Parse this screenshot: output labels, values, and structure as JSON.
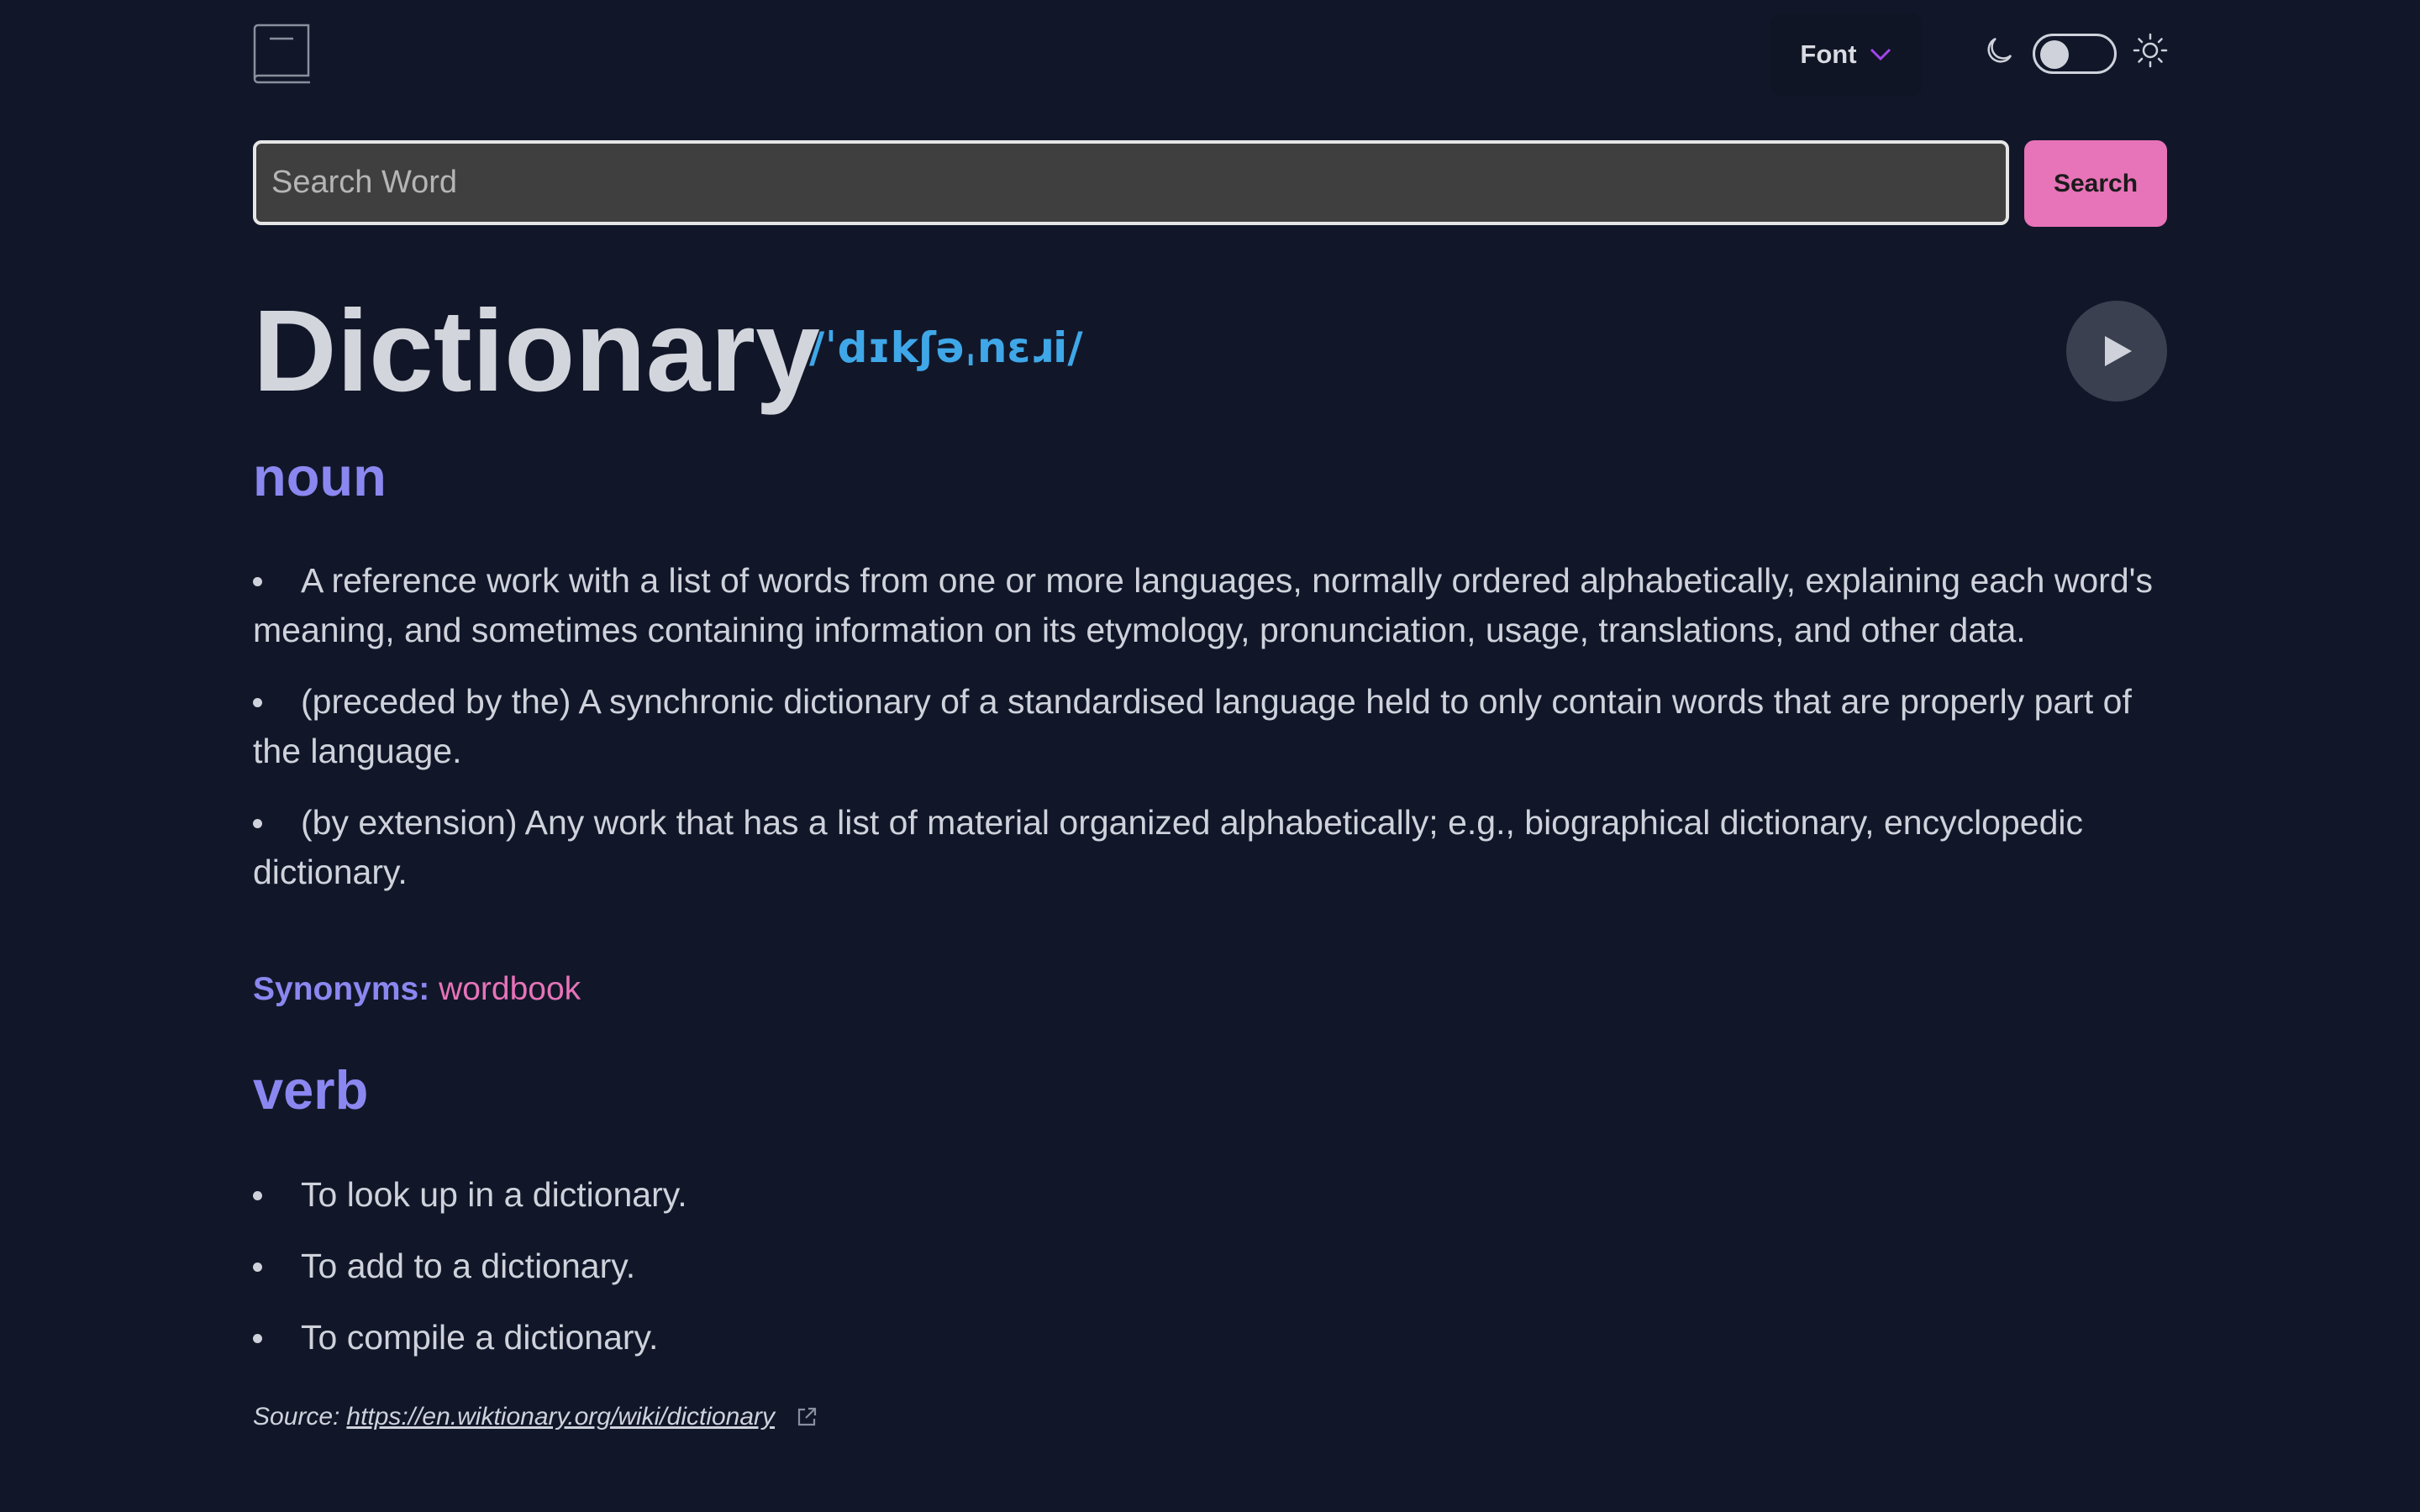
{
  "header": {
    "logo_icon": "book-icon",
    "font_label": "Font",
    "font_chevron_icon": "chevron-down-icon",
    "theme": {
      "moon_icon": "moon-icon",
      "sun_icon": "sun-icon",
      "mode": "dark"
    }
  },
  "search": {
    "placeholder": "Search Word",
    "value": "",
    "button_label": "Search"
  },
  "entry": {
    "word": "Dictionary",
    "phonetic": "/ˈdɪkʃəˌnɛɹi/",
    "play_icon": "play-icon",
    "meanings": [
      {
        "part_of_speech": "noun",
        "definitions": [
          "A reference work with a list of words from one or more languages, normally ordered alphabetically, explaining each word's meaning, and sometimes containing information on its etymology, pronunciation, usage, translations, and other data.",
          "(preceded by the) A synchronic dictionary of a standardised language held to only contain words that are properly part of the language.",
          "(by extension) Any work that has a list of material organized alphabetically; e.g., biographical dictionary, encyclopedic dictionary."
        ],
        "synonyms_label": "Synonyms:",
        "synonyms": [
          "wordbook"
        ]
      },
      {
        "part_of_speech": "verb",
        "definitions": [
          "To look up in a dictionary.",
          "To add to a dictionary.",
          "To compile a dictionary."
        ]
      }
    ],
    "source_label": "Source:",
    "source_url": "https://en.wiktionary.org/wiki/dictionary",
    "external_link_icon": "external-link-icon"
  },
  "colors": {
    "background": "#111729",
    "accent_purple": "#8b87f0",
    "accent_pink": "#e773b8",
    "phonetic_blue": "#3fa7e8"
  }
}
